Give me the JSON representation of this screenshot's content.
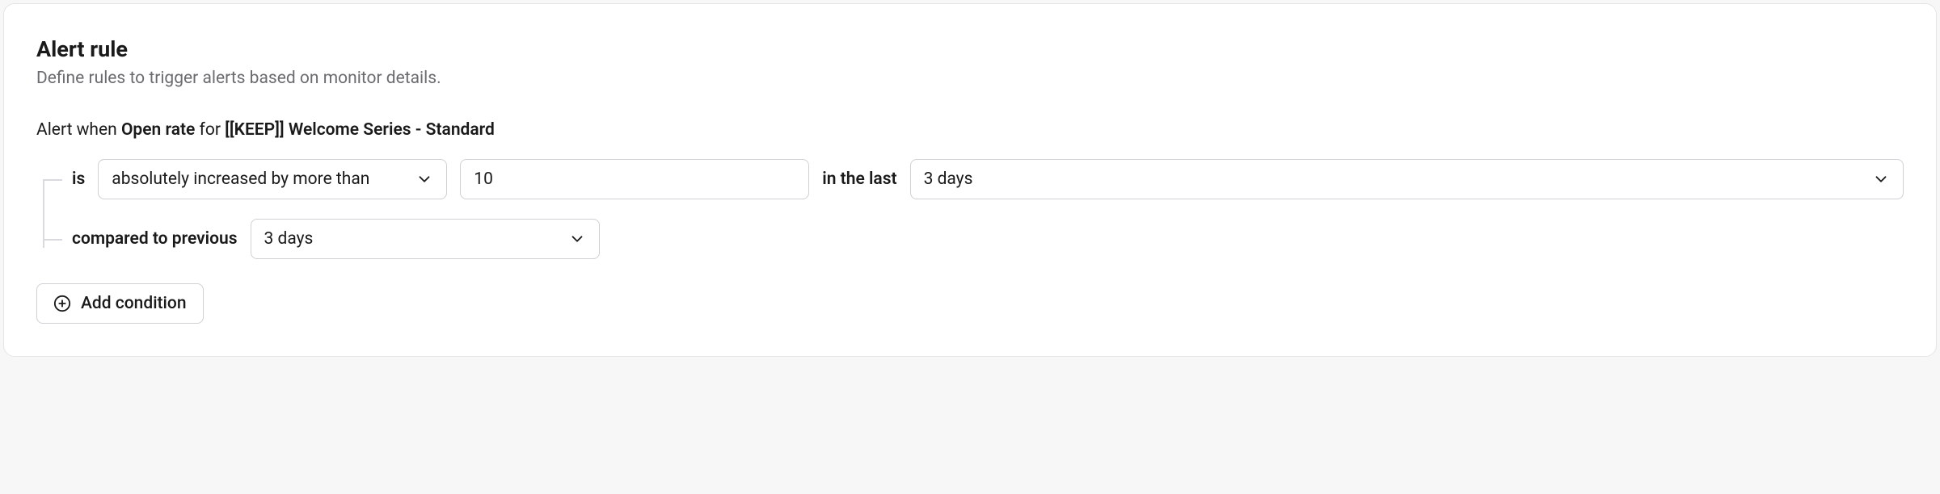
{
  "header": {
    "title": "Alert rule",
    "subtitle": "Define rules to trigger alerts based on monitor details."
  },
  "sentence": {
    "prefix": "Alert when ",
    "metric": "Open rate",
    "for_word": " for ",
    "target": "[[KEEP]] Welcome Series - Standard"
  },
  "condition1": {
    "is_label": "is",
    "comparison": "absolutely increased by more than",
    "value": "10",
    "in_the_last_label": "in the last",
    "time_window": "3 days"
  },
  "condition2": {
    "compared_label": "compared to previous",
    "time_window": "3 days"
  },
  "add_button": {
    "label": "Add condition"
  }
}
